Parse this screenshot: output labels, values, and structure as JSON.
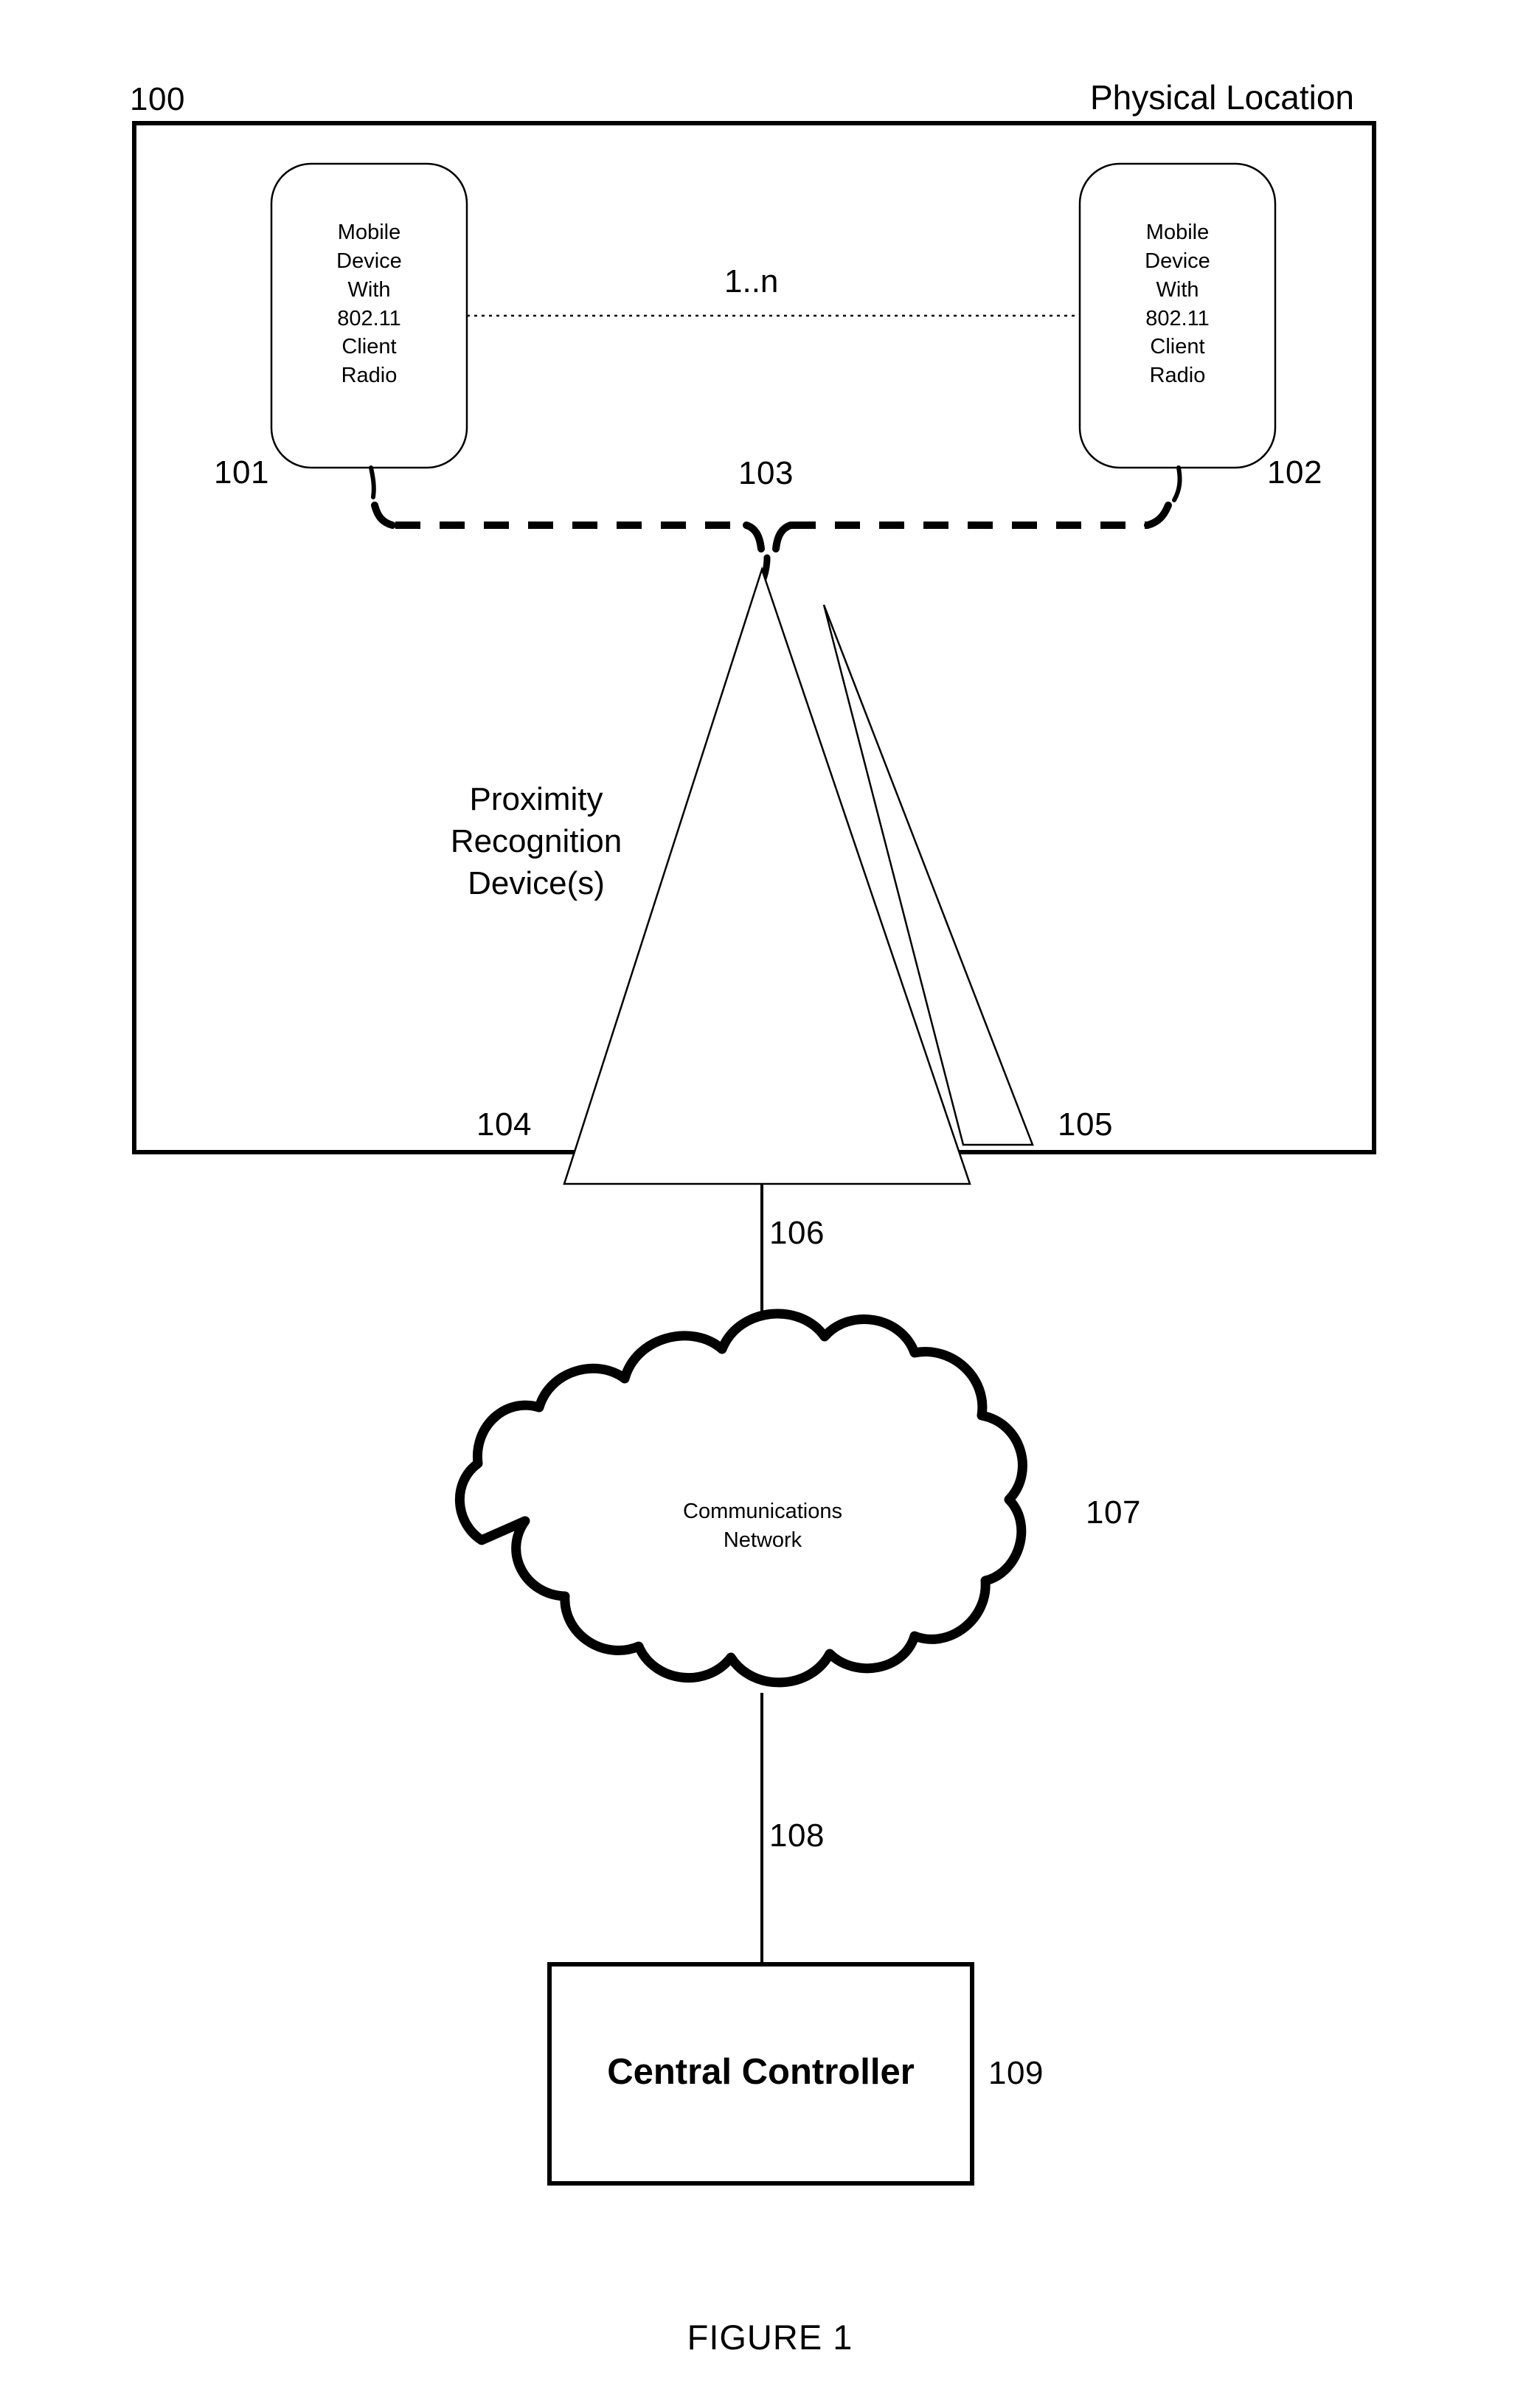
{
  "figure": {
    "caption": "FIGURE 1",
    "outer_boundary_label": "100",
    "outer_boundary_title": "Physical Location"
  },
  "devices": [
    {
      "ref": "101",
      "lines": [
        "Mobile",
        "Device",
        "With",
        "802.11",
        "Client",
        "Radio"
      ],
      "text": "Mobile\nDevice\nWith\n802.11\nClient\nRadio"
    },
    {
      "ref": "102",
      "lines": [
        "Mobile",
        "Device",
        "With",
        "802.11",
        "Client",
        "Radio"
      ],
      "text": "Mobile\nDevice\nWith\n802.11\nClient\nRadio"
    }
  ],
  "links": {
    "cardinality": "1..n",
    "wireless_link_ref": "103",
    "prd_to_network_ref": "106",
    "network_to_controller_ref": "108"
  },
  "proximity_recognition": {
    "label": "Proximity\nRecognition\nDevice(s)",
    "label_lines": [
      "Proximity",
      "Recognition",
      "Device(s)"
    ],
    "antenna_front_ref": "104",
    "antenna_rear_ref": "105"
  },
  "network": {
    "label": "Communications\nNetwork",
    "label_lines": [
      "Communications",
      "Network"
    ],
    "ref": "107"
  },
  "controller": {
    "label": "Central Controller",
    "ref": "109"
  },
  "colors": {
    "ink": "#000000",
    "paper": "#ffffff"
  }
}
